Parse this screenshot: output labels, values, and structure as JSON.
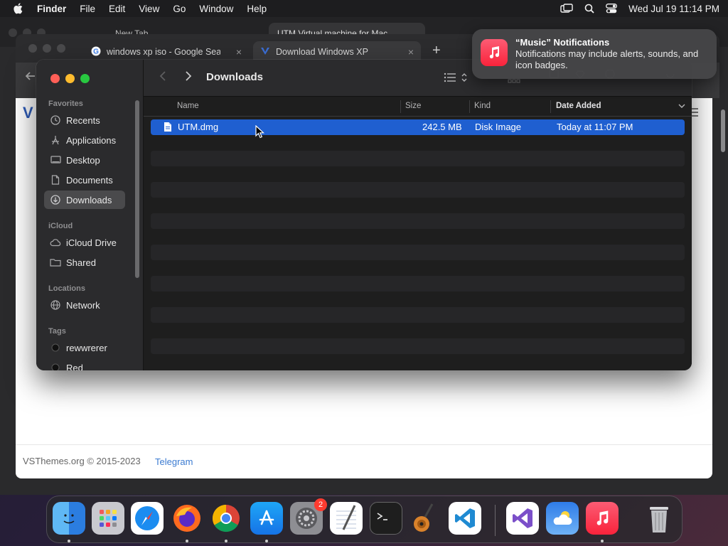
{
  "menubar": {
    "app_name": "Finder",
    "items": [
      "File",
      "Edit",
      "View",
      "Go",
      "Window",
      "Help"
    ],
    "clock": "Wed Jul 19  11:14 PM"
  },
  "back_browser": {
    "tabs": [
      "New Tab",
      "UTM Virtual machine for Mac"
    ],
    "footer_text": "VSThemes.org © 2015-2023",
    "footer_link": "Telegram"
  },
  "browser": {
    "tabs": [
      {
        "title": "windows xp iso - Google Searc",
        "close": "×"
      },
      {
        "title": "Download Windows XP",
        "close": "×"
      }
    ],
    "new_tab": "+"
  },
  "notification": {
    "title": "“Music” Notifications",
    "body": "Notifications may include alerts, sounds, and icon badges."
  },
  "finder": {
    "title": "Downloads",
    "sidebar": {
      "sections": {
        "favorites": "Favorites",
        "icloud": "iCloud",
        "locations": "Locations",
        "tags": "Tags"
      },
      "favorites": [
        {
          "label": "Recents",
          "icon": "clock-icon"
        },
        {
          "label": "Applications",
          "icon": "applications-icon"
        },
        {
          "label": "Desktop",
          "icon": "desktop-icon"
        },
        {
          "label": "Documents",
          "icon": "document-icon"
        },
        {
          "label": "Downloads",
          "icon": "download-icon"
        }
      ],
      "icloud": [
        {
          "label": "iCloud Drive",
          "icon": "cloud-icon"
        },
        {
          "label": "Shared",
          "icon": "shared-folder-icon"
        }
      ],
      "locations": [
        {
          "label": "Network",
          "icon": "globe-icon"
        }
      ],
      "tags": [
        {
          "label": "rewwrerer",
          "color": "#1a1a1a"
        },
        {
          "label": "Red",
          "color": "#1a1a1a"
        }
      ]
    },
    "columns": {
      "name": "Name",
      "size": "Size",
      "kind": "Kind",
      "date_added": "Date Added"
    },
    "files": [
      {
        "name": "UTM.dmg",
        "size": "242.5 MB",
        "kind": "Disk Image",
        "date_added": "Today at 11:07 PM"
      }
    ],
    "selection_color": "#1f5fd0"
  },
  "dock": {
    "apps": [
      "Finder",
      "Launchpad",
      "Safari",
      "Firefox",
      "Chrome",
      "App Store",
      "System Settings",
      "TextEdit",
      "Terminal",
      "GarageBand",
      "Visual Studio Code",
      "Visual Studio",
      "Weather",
      "Music",
      "Trash"
    ],
    "settings_badge": "2"
  }
}
